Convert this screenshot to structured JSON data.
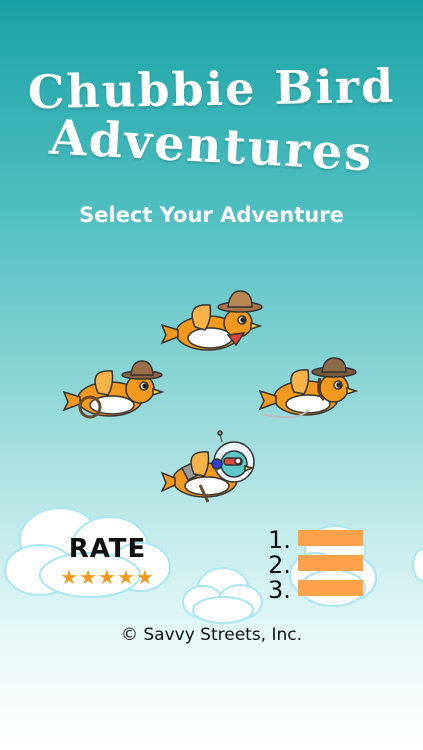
{
  "title": {
    "line1": "Chubbie Bird",
    "line2": "Adventures"
  },
  "subtitle": "Select Your Adventure",
  "adventures": [
    {
      "name": "cowboy"
    },
    {
      "name": "explorer"
    },
    {
      "name": "pirate"
    },
    {
      "name": "astronaut"
    }
  ],
  "rate": {
    "label": "RATE",
    "stars": "★★★★★"
  },
  "leaderboard": {
    "ranks": [
      "1.",
      "2.",
      "3."
    ]
  },
  "footer": {
    "copyright": "© Savvy Streets, Inc."
  },
  "colors": {
    "background_top": "#1aa3a6",
    "bird_orange": "#f39a1e",
    "bar_orange": "#ffa24a"
  }
}
